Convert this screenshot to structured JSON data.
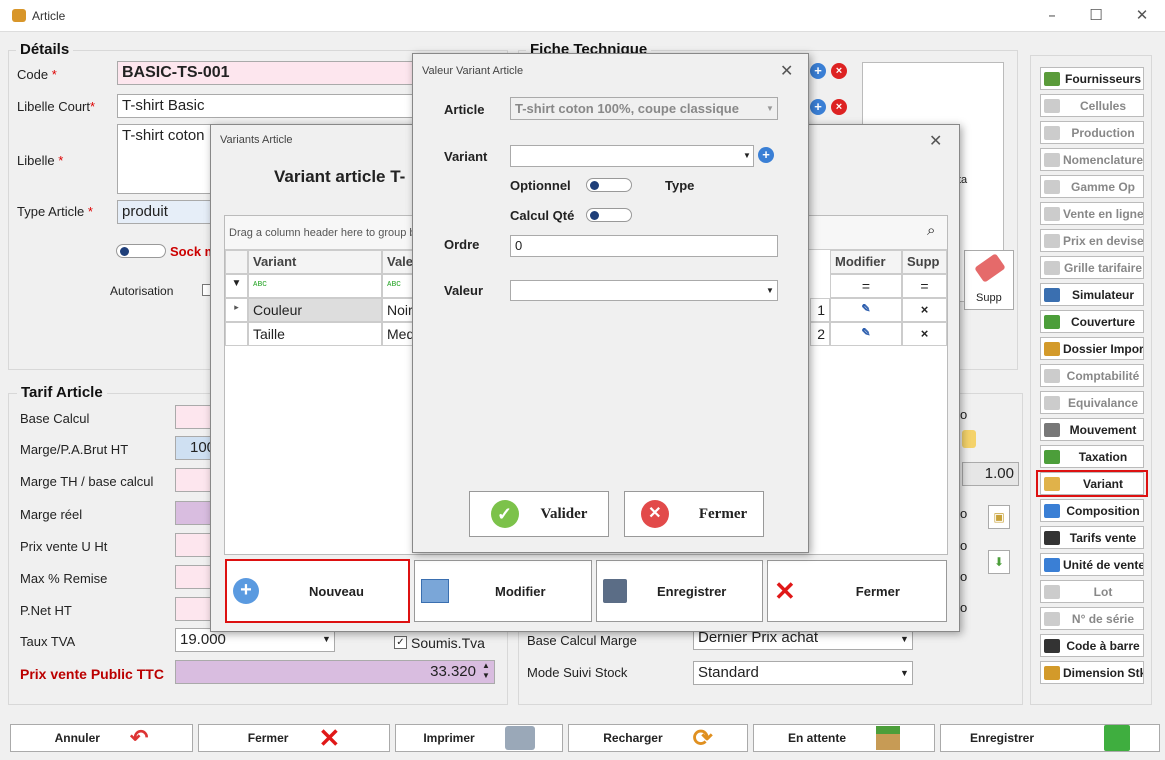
{
  "window": {
    "title": "Article"
  },
  "details": {
    "title": "Détails",
    "code_label": "Code",
    "code_value": "BASIC-TS-001",
    "libelle_court_label": "Libelle Court",
    "libelle_court_value": "T-shirt  Basic",
    "libelle_label": "Libelle",
    "libelle_value": "T-shirt coton",
    "type_label": "Type Article",
    "type_value": "produit",
    "stock_label": "Sock m",
    "autorisation_label": "Autorisation"
  },
  "fiche": {
    "title": "Fiche Technique",
    "ta_text": "ta",
    "supp_label": "Supp"
  },
  "tarif": {
    "title": "Tarif Article",
    "base_calcul": "Base Calcul",
    "marge_pa": "Marge/P.A.Brut HT",
    "marge_pa_value": "100",
    "marge_th": "Marge TH / base calcul",
    "marge_reel": "Marge réel",
    "prix_vente": "Prix vente U Ht",
    "max_remise": "Max % Remise",
    "pnet": "P.Net HT",
    "taux_tva": "Taux TVA",
    "taux_tva_value": "19.000",
    "soumis_tva": "Soumis.Tva",
    "prix_ttc": "Prix vente Public TTC",
    "prix_ttc_value": "33.320"
  },
  "right_panel": {
    "base_calcul_marge": "Base Calcul Marge",
    "base_calcul_marge_value": "Dernier Prix achat",
    "mode_suivi": "Mode Suivi Stock",
    "mode_suivi_value": "Standard",
    "coef_value": "1.00",
    "o_label": "o"
  },
  "side_buttons": [
    {
      "label": "Fournisseurs",
      "icon": "suppliers-icon",
      "disabled": false,
      "color": "#5a9b3a"
    },
    {
      "label": "Cellules",
      "icon": "cells-icon",
      "disabled": true,
      "color": "#ccc"
    },
    {
      "label": "Production",
      "icon": "production-icon",
      "disabled": true,
      "color": "#ccc"
    },
    {
      "label": "Nomenclature",
      "icon": "nomenclature-icon",
      "disabled": true,
      "color": "#ccc"
    },
    {
      "label": "Gamme Op",
      "icon": "gamme-icon",
      "disabled": true,
      "color": "#ccc"
    },
    {
      "label": "Vente en ligne",
      "icon": "cart-icon",
      "disabled": true,
      "color": "#ccc"
    },
    {
      "label": "Prix en devise",
      "icon": "currency-icon",
      "disabled": true,
      "color": "#ccc"
    },
    {
      "label": "Grille tarifaire",
      "icon": "grid-price-icon",
      "disabled": true,
      "color": "#ccc"
    },
    {
      "label": "Simulateur",
      "icon": "calculator-icon",
      "disabled": false,
      "color": "#3a6fb0"
    },
    {
      "label": "Couverture",
      "icon": "coverage-icon",
      "disabled": false,
      "color": "#4c9e3a"
    },
    {
      "label": "Dossier Import",
      "icon": "import-folder-icon",
      "disabled": false,
      "color": "#d39a2a"
    },
    {
      "label": "Comptabilité",
      "icon": "accounting-icon",
      "disabled": true,
      "color": "#ccc"
    },
    {
      "label": "Equivalance",
      "icon": "equivalence-icon",
      "disabled": true,
      "color": "#ccc"
    },
    {
      "label": "Mouvement",
      "icon": "movement-icon",
      "disabled": false,
      "color": "#777"
    },
    {
      "label": "Taxation",
      "icon": "taxation-icon",
      "disabled": false,
      "color": "#4c9e3a"
    },
    {
      "label": "Variant",
      "icon": "variant-icon",
      "disabled": false,
      "color": "#e0b24a"
    },
    {
      "label": "Composition",
      "icon": "composition-icon",
      "disabled": false,
      "color": "#3a7fd5"
    },
    {
      "label": "Tarifs vente",
      "icon": "percent-icon",
      "disabled": false,
      "color": "#333"
    },
    {
      "label": "Unité de vente",
      "icon": "unit-icon",
      "disabled": false,
      "color": "#3a7fd5"
    },
    {
      "label": "Lot",
      "icon": "lot-icon",
      "disabled": true,
      "color": "#ccc"
    },
    {
      "label": "N° de série",
      "icon": "serial-icon",
      "disabled": true,
      "color": "#ccc"
    },
    {
      "label": "Code à barre",
      "icon": "barcode-icon",
      "disabled": false,
      "color": "#333"
    },
    {
      "label": "Dimension Stk",
      "icon": "dimension-icon",
      "disabled": false,
      "color": "#d39a2a"
    }
  ],
  "bottom_buttons": {
    "annuler": "Annuler",
    "fermer": "Fermer",
    "imprimer": "Imprimer",
    "recharger": "Recharger",
    "en_attente": "En attente",
    "enregistrer": "Enregistrer"
  },
  "variants_dialog": {
    "title": "Variants Article",
    "heading": "Variant article T-",
    "group_hint": "Drag a column header here to group b",
    "columns": {
      "variant": "Variant",
      "valeur": "Vale",
      "modifier": "Modifier",
      "supp": "Supp"
    },
    "rows": [
      {
        "variant": "Couleur",
        "valeur": "Noir",
        "num": "1"
      },
      {
        "variant": "Taille",
        "valeur": "Med",
        "num": "2"
      }
    ],
    "delete_glyph": "×",
    "buttons": {
      "nouveau": "Nouveau",
      "modifier": "Modifier",
      "enregistrer": "Enregistrer",
      "fermer": "Fermer"
    }
  },
  "valeur_dialog": {
    "title": "Valeur Variant Article",
    "article_label": "Article",
    "article_value": "T-shirt coton 100%, coupe classique",
    "variant_label": "Variant",
    "variant_value": "",
    "optionnel_label": "Optionnel",
    "type_label": "Type",
    "calcul_label": "Calcul Qté",
    "ordre_label": "Ordre",
    "ordre_value": "0",
    "valeur_label": "Valeur",
    "valeur_value": "",
    "valider": "Valider",
    "fermer": "Fermer"
  }
}
